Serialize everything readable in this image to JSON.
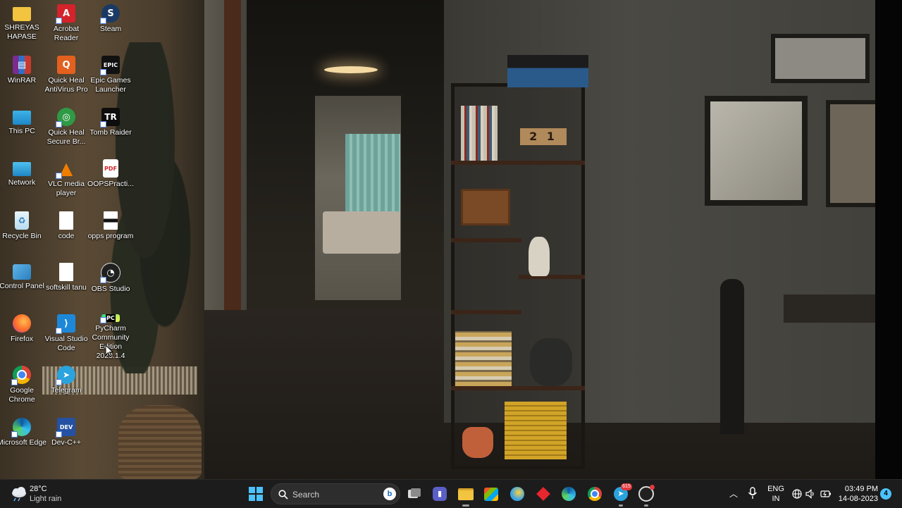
{
  "desktop": {
    "icons": [
      {
        "label": "SHREYAS HAPASE",
        "icon": "folder-icon"
      },
      {
        "label": "Acrobat Reader",
        "icon": "acrobat-icon"
      },
      {
        "label": "Steam",
        "icon": "steam-icon"
      },
      {
        "label": "WinRAR",
        "icon": "winrar-icon"
      },
      {
        "label": "Quick Heal AntiVirus Pro",
        "icon": "quickheal-antivirus-icon"
      },
      {
        "label": "Epic Games Launcher",
        "icon": "epic-games-icon"
      },
      {
        "label": "This PC",
        "icon": "monitor-icon"
      },
      {
        "label": "Quick Heal Secure Br...",
        "icon": "quickheal-browser-icon"
      },
      {
        "label": "Tomb Raider",
        "icon": "tomb-raider-icon"
      },
      {
        "label": "Network",
        "icon": "network-icon"
      },
      {
        "label": "VLC media player",
        "icon": "vlc-icon"
      },
      {
        "label": "OOPSPracti...",
        "icon": "pdf-icon"
      },
      {
        "label": "Recycle Bin",
        "icon": "recycle-bin-icon"
      },
      {
        "label": "code",
        "icon": "document-icon"
      },
      {
        "label": "opps program",
        "icon": "document-icon"
      },
      {
        "label": "Control Panel",
        "icon": "control-panel-icon"
      },
      {
        "label": "softskill tanu",
        "icon": "document-icon"
      },
      {
        "label": "OBS Studio",
        "icon": "obs-icon"
      },
      {
        "label": "Firefox",
        "icon": "firefox-icon"
      },
      {
        "label": "Visual Studio Code",
        "icon": "vscode-icon"
      },
      {
        "label": "PyCharm Community Edition 2023.1.4",
        "icon": "pycharm-icon"
      },
      {
        "label": "Google Chrome",
        "icon": "chrome-icon"
      },
      {
        "label": "Telegram",
        "icon": "telegram-icon"
      },
      {
        "label": "Microsoft Edge",
        "icon": "edge-icon"
      },
      {
        "label": "Dev-C++",
        "icon": "devcpp-icon"
      }
    ],
    "wallpaper_calendar": "2 1"
  },
  "taskbar": {
    "weather": {
      "temp": "28°C",
      "condition": "Light rain"
    },
    "search_label": "Search",
    "telegram_badge": "615",
    "tray": {
      "lang_top": "ENG",
      "lang_bottom": "IN",
      "time": "03:49 PM",
      "date": "14-08-2023",
      "notification_count": "4"
    }
  },
  "colors": {
    "taskbar_bg": "#1c1c1c",
    "accent_blue": "#0078d4",
    "folder_yellow": "#f2c440"
  }
}
